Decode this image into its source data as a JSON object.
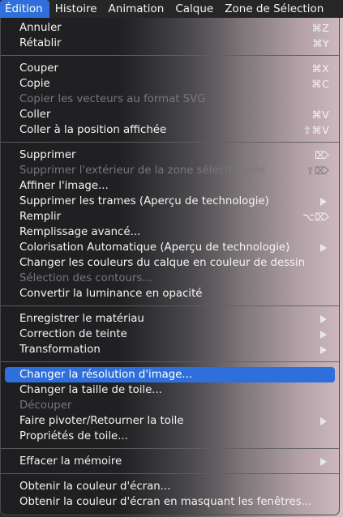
{
  "menubar": {
    "items": [
      "Édition",
      "Histoire",
      "Animation",
      "Calque",
      "Zone de Sélection"
    ]
  },
  "menu": {
    "annuler": {
      "label": "Annuler",
      "shortcut": "⌘Z"
    },
    "retablir": {
      "label": "Rétablir",
      "shortcut": "⌘Y"
    },
    "couper": {
      "label": "Couper",
      "shortcut": "⌘X"
    },
    "copie": {
      "label": "Copie",
      "shortcut": "⌘C"
    },
    "copier_svg": {
      "label": "Copier les vecteurs au format SVG"
    },
    "coller": {
      "label": "Coller",
      "shortcut": "⌘V"
    },
    "coller_position": {
      "label": "Coller à la position affichée",
      "shortcut": "⇧⌘V"
    },
    "supprimer": {
      "label": "Supprimer",
      "shortcut": "⌦"
    },
    "supprimer_exterieur": {
      "label": "Supprimer l'extérieur de la zone sélectionnée",
      "shortcut": "⇧⌦"
    },
    "affiner": {
      "label": "Affiner l'image..."
    },
    "supprimer_trames": {
      "label": "Supprimer les trames (Aperçu de technologie)"
    },
    "remplir": {
      "label": "Remplir",
      "shortcut": "⌥⌦"
    },
    "remplissage_avance": {
      "label": "Remplissage avancé..."
    },
    "colorisation": {
      "label": "Colorisation Automatique (Aperçu de technologie)"
    },
    "changer_couleurs": {
      "label": "Changer les couleurs du calque en couleur de dessin"
    },
    "selection_contours": {
      "label": "Sélection des contours..."
    },
    "convertir_luminance": {
      "label": "Convertir la luminance en opacité"
    },
    "enregistrer_materiau": {
      "label": "Enregistrer le matériau"
    },
    "correction_teinte": {
      "label": "Correction de teinte"
    },
    "transformation": {
      "label": "Transformation"
    },
    "changer_resolution": {
      "label": "Changer la résolution d'image..."
    },
    "changer_taille_toile": {
      "label": "Changer la taille de toile..."
    },
    "decouper": {
      "label": "Découper"
    },
    "faire_pivoter": {
      "label": "Faire pivoter/Retourner la toile"
    },
    "proprietes_toile": {
      "label": "Propriétés de toile..."
    },
    "effacer_memoire": {
      "label": "Effacer la mémoire"
    },
    "obtenir_couleur": {
      "label": "Obtenir la couleur d'écran..."
    },
    "obtenir_couleur_masquant": {
      "label": "Obtenir la couleur d'écran en masquant les fenêtres..."
    }
  },
  "colors": {
    "highlight": "#2f6fdb",
    "text": "#f4f4f4",
    "disabled_text": "#77777a",
    "menubar_bg": "#262627"
  }
}
